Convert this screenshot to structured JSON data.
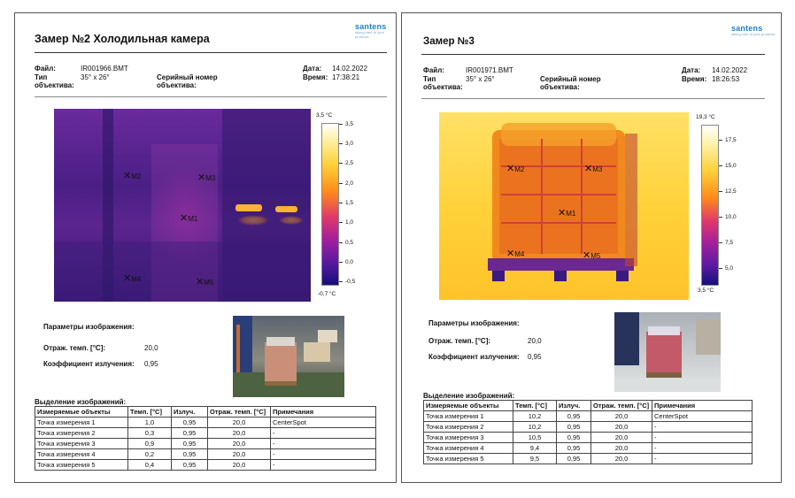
{
  "reports": [
    {
      "logo": "santens",
      "logo_tag": "taking care of your products",
      "title": "Замер №2 Холодильная камера",
      "file_label": "Файл:",
      "file_value": "IR001966.BMT",
      "lens_label": "Тип объектива:",
      "lens_value": "35° x 26°",
      "serial_label": "Серийный номер объектива:",
      "date_label": "Дата:",
      "date_value": "14.02.2022",
      "time_label": "Время:",
      "time_value": "17:38:21",
      "scale_max": "3,5 °C",
      "scale_min": "-0,7 °C",
      "ticks": [
        "3,5",
        "3,0",
        "2,5",
        "2,0",
        "1,5",
        "1,0",
        "0,5",
        "0,0",
        "-0,5"
      ],
      "markers": [
        "M2",
        "M3",
        "M1",
        "M4",
        "M5"
      ],
      "params_title": "Параметры изображения:",
      "refl_label": "Отраж. темп. [°C]:",
      "refl_value": "20,0",
      "emis_label": "Коэффициент излучения:",
      "emis_value": "0,95",
      "selection_title": "Выделение изображений:",
      "headers": [
        "Измеряемые объекты",
        "Темп. [°C]",
        "Излуч.",
        "Отраж. темп. [°C]",
        "Примечания"
      ],
      "rows": [
        [
          "Точка измерения 1",
          "1,0",
          "0,95",
          "20,0",
          "CenterSpot"
        ],
        [
          "Точка измерения 2",
          "0,3",
          "0,95",
          "20,0",
          "-"
        ],
        [
          "Точка измерения 3",
          "0,9",
          "0,95",
          "20,0",
          "-"
        ],
        [
          "Точка измерения 4",
          "0,2",
          "0,95",
          "20,0",
          "-"
        ],
        [
          "Точка измерения 5",
          "0,4",
          "0,95",
          "20,0",
          "-"
        ]
      ]
    },
    {
      "logo": "santens",
      "logo_tag": "taking care of your products",
      "title": "Замер №3",
      "file_label": "Файл:",
      "file_value": "IR001971.BMT",
      "lens_label": "Тип объектива:",
      "lens_value": "35° x 26°",
      "serial_label": "Серийный номер объектива:",
      "date_label": "Дата:",
      "date_value": "14.02.2022",
      "time_label": "Время:",
      "time_value": "18:26:53",
      "scale_max": "19,3 °C",
      "scale_min": "3,5 °C",
      "ticks": [
        "17,5",
        "15,0",
        "12,5",
        "10,0",
        "7,5",
        "5,0"
      ],
      "markers": [
        "M2",
        "M3",
        "M1",
        "M4",
        "M5"
      ],
      "params_title": "Параметры изображения:",
      "refl_label": "Отраж. темп. [°C]:",
      "refl_value": "20,0",
      "emis_label": "Коэффициент излучения:",
      "emis_value": "0,95",
      "selection_title": "Выделение изображений:",
      "headers": [
        "Измеряемые объекты",
        "Темп. [°C]",
        "Излуч.",
        "Отраж. темп. [°C]",
        "Примечания"
      ],
      "rows": [
        [
          "Точка измерения 1",
          "10,2",
          "0,95",
          "20,0",
          "CenterSpot"
        ],
        [
          "Точка измерения 2",
          "10,2",
          "0,95",
          "20,0",
          "-"
        ],
        [
          "Точка измерения 3",
          "10,5",
          "0,95",
          "20,0",
          "-"
        ],
        [
          "Точка измерения 4",
          "9,4",
          "0,95",
          "20,0",
          "-"
        ],
        [
          "Точка измерения 5",
          "9,5",
          "0,95",
          "20,0",
          "-"
        ]
      ]
    }
  ]
}
